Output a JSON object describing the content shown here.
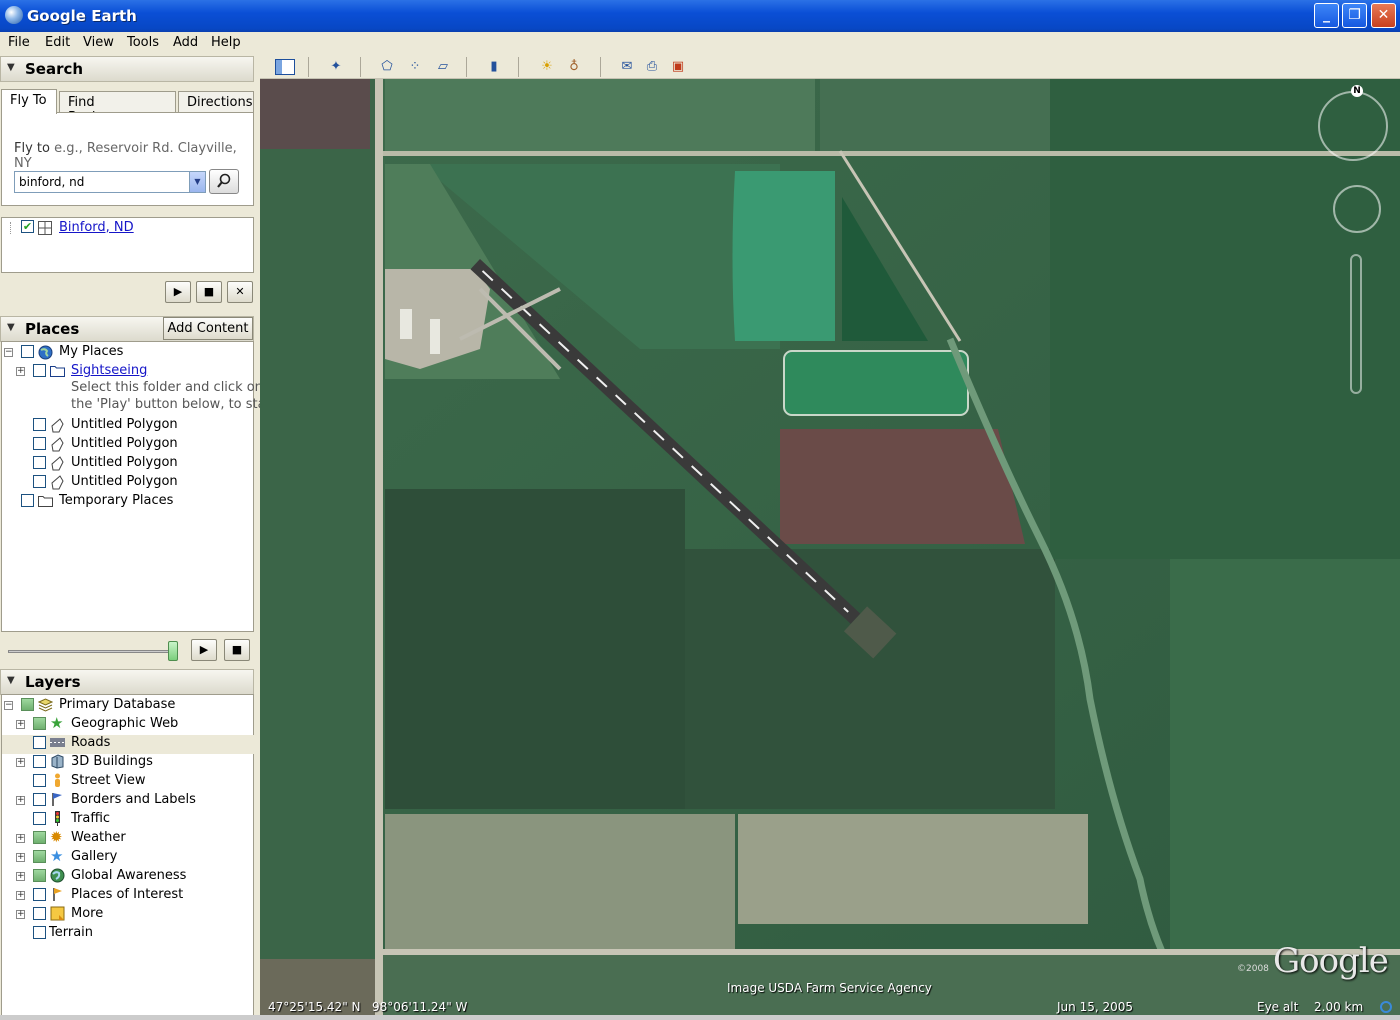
{
  "window": {
    "title": "Google Earth"
  },
  "menu": [
    "File",
    "Edit",
    "View",
    "Tools",
    "Add",
    "Help"
  ],
  "search": {
    "header": "Search",
    "tabs": [
      "Fly To",
      "Find Businesses",
      "Directions"
    ],
    "fly_to_label": "Fly to",
    "fly_to_hint": "e.g., Reservoir Rd. Clayville, NY",
    "fly_to_value": "binford, nd",
    "results": [
      {
        "label": "Binford, ND",
        "checked": true
      }
    ]
  },
  "places": {
    "header": "Places",
    "add_content": "Add Content",
    "items": [
      {
        "label": "My Places"
      },
      {
        "label": "Sightseeing"
      },
      {
        "label": "Select this folder and click on"
      },
      {
        "label": "the 'Play' button below, to start"
      },
      {
        "label": "Untitled Polygon"
      },
      {
        "label": "Untitled Polygon"
      },
      {
        "label": "Untitled Polygon"
      },
      {
        "label": "Untitled Polygon"
      },
      {
        "label": "Temporary Places"
      }
    ]
  },
  "layers": {
    "header": "Layers",
    "items": [
      {
        "label": "Primary Database"
      },
      {
        "label": "Geographic Web"
      },
      {
        "label": "Roads"
      },
      {
        "label": "3D Buildings"
      },
      {
        "label": "Street View"
      },
      {
        "label": "Borders and Labels"
      },
      {
        "label": "Traffic"
      },
      {
        "label": "Weather"
      },
      {
        "label": "Gallery"
      },
      {
        "label": "Global Awareness"
      },
      {
        "label": "Places of Interest"
      },
      {
        "label": "More"
      },
      {
        "label": "Terrain"
      }
    ]
  },
  "map": {
    "imagery_credit": "Image USDA Farm Service Agency",
    "latitude": "47°25'15.42\" N",
    "longitude": "98°06'11.24\" W",
    "date": "Jun 15, 2005",
    "eye_alt_label": "Eye alt",
    "eye_alt_value": "2.00 km",
    "copyright": "©2008",
    "logo": "Google",
    "compass_letter": "N"
  }
}
